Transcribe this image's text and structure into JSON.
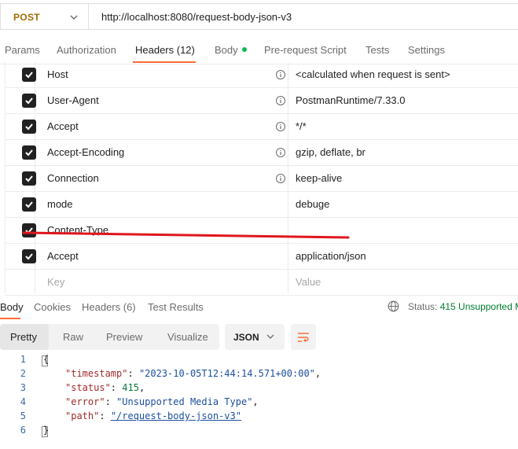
{
  "request": {
    "method": "POST",
    "url": "http://localhost:8080/request-body-json-v3"
  },
  "request_tabs": [
    {
      "label": "Params"
    },
    {
      "label": "Authorization"
    },
    {
      "label": "Headers (12)"
    },
    {
      "label": "Body"
    },
    {
      "label": "Pre-request Script"
    },
    {
      "label": "Tests"
    },
    {
      "label": "Settings"
    }
  ],
  "headers": [
    {
      "key": "Host",
      "value": "<calculated when request is sent>",
      "checked": true,
      "info": true
    },
    {
      "key": "User-Agent",
      "value": "PostmanRuntime/7.33.0",
      "checked": true,
      "info": true
    },
    {
      "key": "Accept",
      "value": "*/*",
      "checked": true,
      "info": true
    },
    {
      "key": "Accept-Encoding",
      "value": "gzip, deflate, br",
      "checked": true,
      "info": true
    },
    {
      "key": "Connection",
      "value": "keep-alive",
      "checked": true,
      "info": true
    },
    {
      "key": "mode",
      "value": "debuge",
      "checked": true,
      "info": false
    },
    {
      "key": "Content-Type",
      "value": "",
      "checked": true,
      "info": false
    },
    {
      "key": "Accept",
      "value": "application/json",
      "checked": true,
      "info": false
    }
  ],
  "new_header": {
    "key_placeholder": "Key",
    "value_placeholder": "Value"
  },
  "response_tabs": [
    {
      "label": "Body"
    },
    {
      "label": "Cookies"
    },
    {
      "label": "Headers (6)"
    },
    {
      "label": "Test Results"
    }
  ],
  "status": {
    "label": "Status:",
    "value": "415 Unsupported M"
  },
  "view_tabs": [
    {
      "label": "Pretty"
    },
    {
      "label": "Raw"
    },
    {
      "label": "Preview"
    },
    {
      "label": "Visualize"
    }
  ],
  "format": "JSON",
  "response_body": {
    "line_numbers": [
      "1",
      "2",
      "3",
      "4",
      "5",
      "6"
    ],
    "timestamp_key": "\"timestamp\"",
    "timestamp_value": "\"2023-10-05T12:44:14.571+00:00\"",
    "status_key": "\"status\"",
    "status_value": "415",
    "error_key": "\"error\"",
    "error_value": "\"Unsupported Media Type\"",
    "path_key": "\"path\"",
    "path_value": "\"/request-body-json-v3\""
  },
  "colors": {
    "accent": "#ff6c37",
    "method": "#a26b00",
    "status_ok": "#007f31",
    "annotation": "#e0161d"
  }
}
